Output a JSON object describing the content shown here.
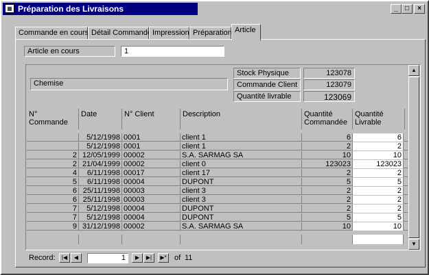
{
  "window": {
    "title": "Préparation des Livraisons",
    "buttons": {
      "minimize": "_",
      "maximize": "□",
      "close": "×"
    }
  },
  "tabs": [
    "Commande en cours",
    "Détail Commande",
    "Impression",
    "Préparation",
    "Article"
  ],
  "active_tab": "Article",
  "header": {
    "article_label": "Article en cours",
    "article_value": "1"
  },
  "summary": {
    "description": "Chemise",
    "stock_label": "Stock Physique",
    "stock_value": "123078",
    "commande_label": "Commande Client",
    "commande_value": "123079",
    "livrable_label": "Quantité livrable",
    "livrable_value": "123069"
  },
  "table": {
    "columns": [
      "N° Commande",
      "Date",
      "N° Client",
      "Description",
      "Quantité Commandée",
      "Quantité Livrable"
    ],
    "rows": [
      [
        "",
        "5/12/1998",
        "0001",
        "client 1",
        "6",
        "6"
      ],
      [
        "",
        "5/12/1998",
        "0001",
        "client 1",
        "2",
        "2"
      ],
      [
        "2",
        "12/05/1999",
        "00002",
        "S.A. SARMAG SA",
        "10",
        "10"
      ],
      [
        "2",
        "21/04/1999",
        "00002",
        "client 0",
        "123023",
        "123023"
      ],
      [
        "4",
        "6/11/1998",
        "00017",
        "client 17",
        "2",
        "2"
      ],
      [
        "5",
        "6/11/1998",
        "00004",
        "DUPONT",
        "5",
        "5"
      ],
      [
        "6",
        "25/11/1998",
        "00003",
        "client 3",
        "2",
        "2"
      ],
      [
        "6",
        "25/11/1998",
        "00003",
        "client 3",
        "2",
        "2"
      ],
      [
        "7",
        "5/12/1998",
        "00004",
        "DUPONT",
        "2",
        "2"
      ],
      [
        "7",
        "5/12/1998",
        "00004",
        "DUPONT",
        "5",
        "5"
      ],
      [
        "9",
        "31/12/1998",
        "00002",
        "S.A. SARMAG SA",
        "10",
        "10"
      ]
    ]
  },
  "navigation": {
    "record_label": "Record:",
    "current": "1",
    "of_label": "of",
    "total": "11",
    "first": "|◀",
    "prev": "◀",
    "next": "▶",
    "last": "▶|",
    "new": "▶*"
  }
}
